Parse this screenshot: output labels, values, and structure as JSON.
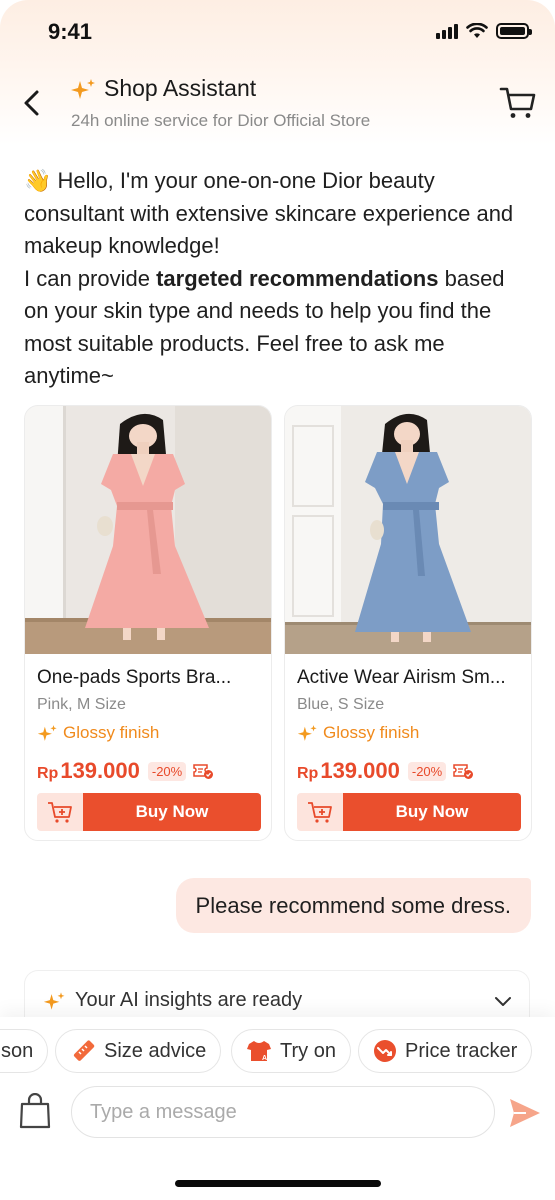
{
  "status_bar": {
    "time": "9:41"
  },
  "header": {
    "title": "Shop Assistant",
    "subtitle": "24h online service for Dior Official Store"
  },
  "greeting": {
    "emoji": "👋",
    "line_a": " Hello, I'm your one-on-one Dior beauty consultant with extensive skincare experience and makeup knowledge!",
    "line_b_pre": "I can provide ",
    "line_b_bold": "targeted recommendations",
    "line_b_post": " based on your skin type and needs to help you find the most suitable products. Feel free to ask me anytime~"
  },
  "products": [
    {
      "name": "One-pads Sports Bra...",
      "variant": "Pink, M Size",
      "tag": "Glossy finish",
      "currency": "Rp",
      "price": "139.000",
      "discount": "-20%",
      "buy_label": "Buy Now",
      "dress_color": "#f4aaa4"
    },
    {
      "name": "Active Wear Airism Sm...",
      "variant": "Blue, S Size",
      "tag": "Glossy finish",
      "currency": "Rp",
      "price": "139.000",
      "discount": "-20%",
      "buy_label": "Buy Now",
      "dress_color": "#7d9dc6"
    }
  ],
  "user_message": "Please recommend some dress.",
  "insights": {
    "label": "Your AI insights are ready"
  },
  "quick_actions": [
    {
      "label": "son",
      "icon": "comparison-icon"
    },
    {
      "label": "Size advice",
      "icon": "ruler-icon"
    },
    {
      "label": "Try on",
      "icon": "tshirt-ai-icon"
    },
    {
      "label": "Price tracker",
      "icon": "price-drop-icon"
    }
  ],
  "composer": {
    "placeholder": "Type a message"
  },
  "colors": {
    "accent": "#ea4f2d",
    "price": "#e84a2b",
    "tag": "#f08a1c",
    "bubble": "#fde8e2"
  }
}
